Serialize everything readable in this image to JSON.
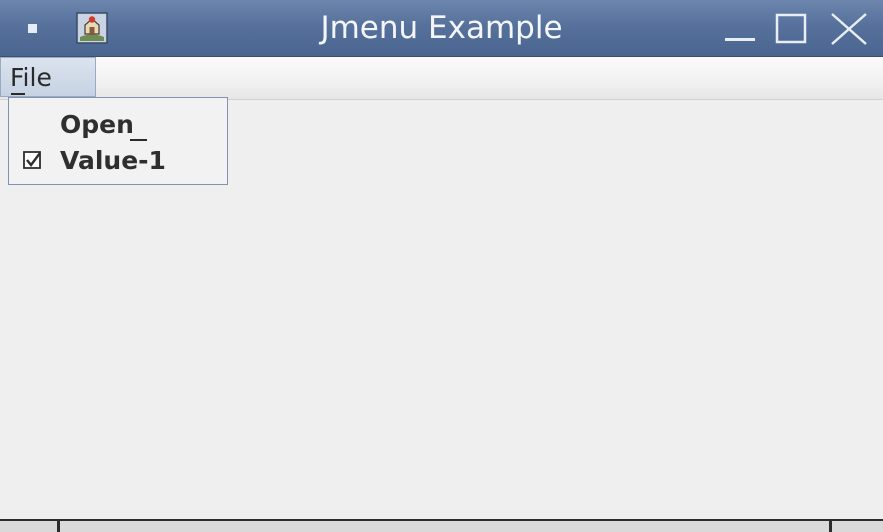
{
  "window": {
    "title": "Jmenu Example"
  },
  "menubar": {
    "file_label": "File"
  },
  "file_menu": {
    "items": [
      {
        "label": "Open",
        "type": "item"
      },
      {
        "label": "Value-1",
        "type": "checkbox",
        "checked": true
      }
    ]
  },
  "icons": {
    "window_menu": "window-menu-icon",
    "app": "java-app-icon",
    "minimize": "minimize-icon",
    "maximize": "maximize-icon",
    "close": "close-icon",
    "checkbox": "checkbox-checked-icon"
  },
  "colors": {
    "titlebar": "#56719b",
    "title_text": "#f4f6fa",
    "menu_highlight": "#c6d2e3",
    "popup_border": "#7f93b4",
    "background": "#efefef"
  }
}
